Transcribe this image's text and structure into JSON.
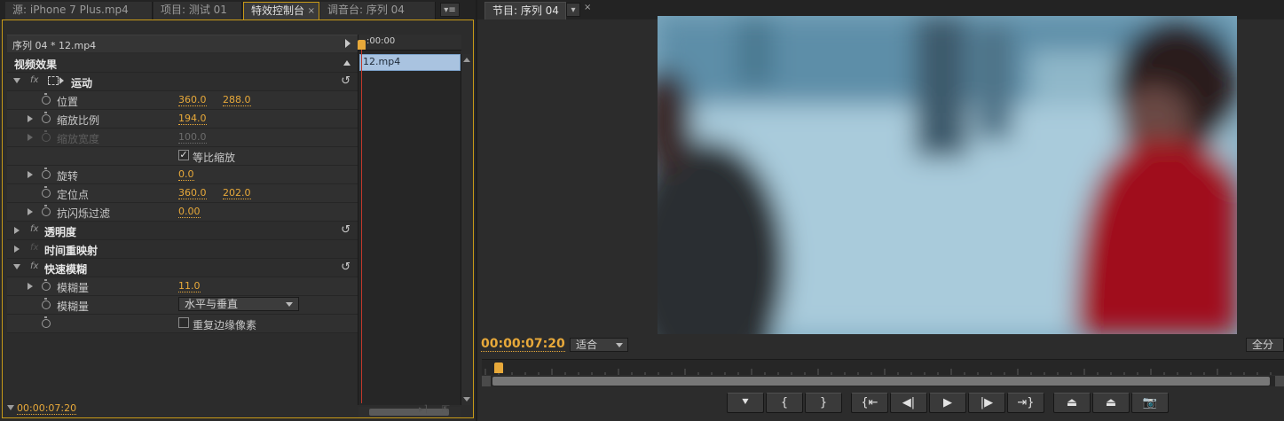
{
  "left_panel": {
    "tabs": [
      {
        "label": "源: iPhone 7 Plus.mp4"
      },
      {
        "label": "项目: 测试 01"
      },
      {
        "label": "特效控制台",
        "active": true
      },
      {
        "label": "调音台: 序列 04"
      }
    ],
    "close_glyph": "×",
    "menu_glyph": "▾≡",
    "header": "序列 04 * 12.mp4",
    "timeline": {
      "ruler_label": ":00:00",
      "clip_label": "12.mp4"
    },
    "sections": {
      "video_effects": "视频效果",
      "motion": {
        "label": "运动",
        "position": {
          "label": "位置",
          "x": "360.0",
          "y": "288.0"
        },
        "scale": {
          "label": "缩放比例",
          "value": "194.0"
        },
        "scale_width": {
          "label": "缩放宽度",
          "value": "100.0"
        },
        "uniform_scale": {
          "label": "等比缩放",
          "checked": true
        },
        "rotation": {
          "label": "旋转",
          "value": "0.0"
        },
        "anchor": {
          "label": "定位点",
          "x": "360.0",
          "y": "202.0"
        },
        "anti_flicker": {
          "label": "抗闪烁过滤",
          "value": "0.00"
        }
      },
      "opacity": "透明度",
      "time_remap": "时间重映射",
      "fast_blur": {
        "label": "快速模糊",
        "blurriness": {
          "label": "模糊量",
          "value": "11.0"
        },
        "dimensions": {
          "label": "模糊量",
          "selected": "水平与垂直"
        },
        "repeat_edge": {
          "label": "重复边缘像素",
          "checked": false
        }
      }
    },
    "fx_glyph": "fx",
    "reset_glyph": "↺",
    "check_glyph": "✓",
    "timecode": "00:00:07:20"
  },
  "right_panel": {
    "tab": "节目: 序列 04",
    "timecode": "00:00:07:20",
    "fit_select": "适合",
    "quality_select": "全分",
    "transport_buttons": [
      {
        "name": "marker-button",
        "glyph": "⯆"
      },
      {
        "name": "mark-in-button",
        "glyph": "{"
      },
      {
        "name": "mark-out-button",
        "glyph": "}"
      },
      {
        "name": "go-to-in-button",
        "glyph": "{⇤"
      },
      {
        "name": "step-back-button",
        "glyph": "◀|"
      },
      {
        "name": "play-button",
        "glyph": "▶"
      },
      {
        "name": "step-forward-button",
        "glyph": "|▶"
      },
      {
        "name": "go-to-out-button",
        "glyph": "⇥}"
      },
      {
        "name": "lift-button",
        "glyph": "⏏"
      },
      {
        "name": "extract-button",
        "glyph": "⏏"
      },
      {
        "name": "export-frame-button",
        "glyph": "📷"
      }
    ]
  },
  "colors": {
    "accent": "#e8a93a",
    "active_border": "#c89a18",
    "clip": "#a9c3e0",
    "playhead_line": "#c0392b"
  }
}
